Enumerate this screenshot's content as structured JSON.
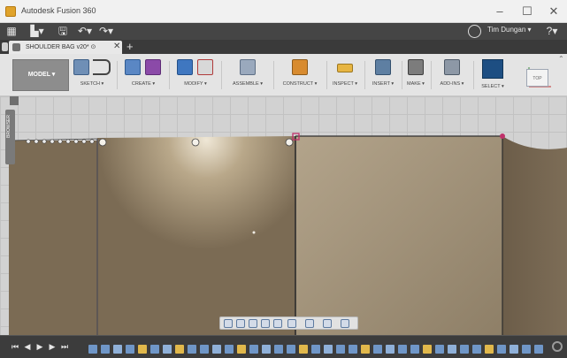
{
  "window": {
    "title": "Autodesk Fusion 360",
    "minimize_label": "–",
    "maximize_label": "☐",
    "close_label": "✕"
  },
  "quick_toolbar": {
    "user_label": "Tim Dungan ▾",
    "help_label": "?▾"
  },
  "document_tab": {
    "label": "SHOULDER BAG v20* ⊙",
    "close_label": "✕",
    "add_label": "+"
  },
  "ribbon": {
    "workspace_label": "MODEL ▾",
    "groups": [
      {
        "label": "SKETCH ▾"
      },
      {
        "label": "CREATE ▾"
      },
      {
        "label": "MODIFY ▾"
      },
      {
        "label": "ASSEMBLE ▾"
      },
      {
        "label": "CONSTRUCT ▾"
      },
      {
        "label": "INSPECT ▾"
      },
      {
        "label": "INSERT ▾"
      },
      {
        "label": "MAKE ▾"
      },
      {
        "label": "ADD-INS ▾"
      },
      {
        "label": "SELECT ▾"
      }
    ]
  },
  "browser": {
    "label": "BROWSER"
  },
  "viewcube": {
    "face_label": "TOP"
  },
  "colors": {
    "body_brown": "#7b6b54",
    "selected_point": "#c0306a",
    "workspace_bg": "#8d8d8d",
    "select_blue": "#1d4e82"
  }
}
